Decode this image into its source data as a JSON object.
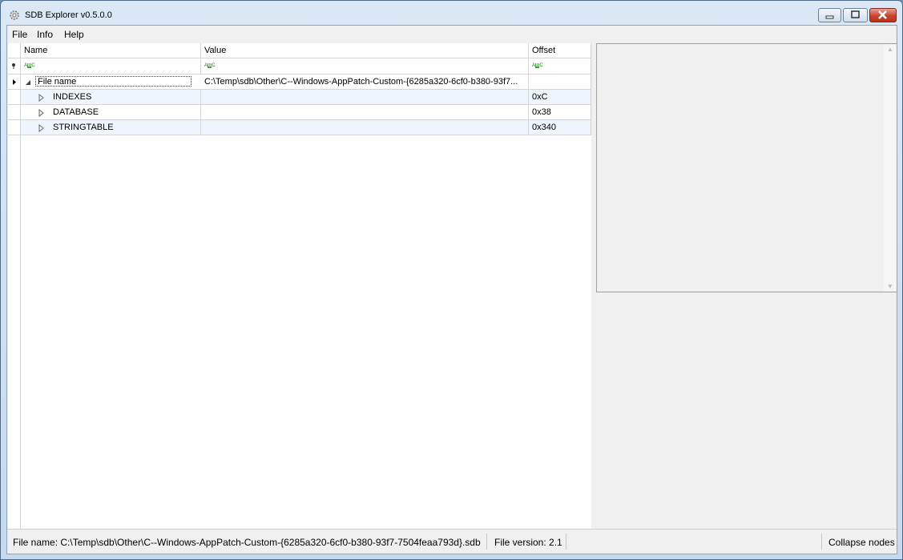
{
  "window": {
    "title": "SDB Explorer v0.5.0.0"
  },
  "menu": {
    "file": "File",
    "info": "Info",
    "help": "Help"
  },
  "grid": {
    "columns": {
      "name": "Name",
      "value": "Value",
      "offset": "Offset"
    },
    "filter_icon_text": "ABC",
    "rows": [
      {
        "name": "File name",
        "value": "C:\\Temp\\sdb\\Other\\C--Windows-AppPatch-Custom-{6285a320-6cf0-b380-93f7...",
        "offset": ""
      },
      {
        "name": "INDEXES",
        "value": "",
        "offset": "0xC"
      },
      {
        "name": "DATABASE",
        "value": "",
        "offset": "0x38"
      },
      {
        "name": "STRINGTABLE",
        "value": "",
        "offset": "0x340"
      }
    ]
  },
  "status": {
    "file_name": "File name: C:\\Temp\\sdb\\Other\\C--Windows-AppPatch-Custom-{6285a320-6cf0-b380-93f7-7504feaa793d}.sdb",
    "file_version": "File version: 2.1",
    "collapse": "Collapse nodes"
  }
}
